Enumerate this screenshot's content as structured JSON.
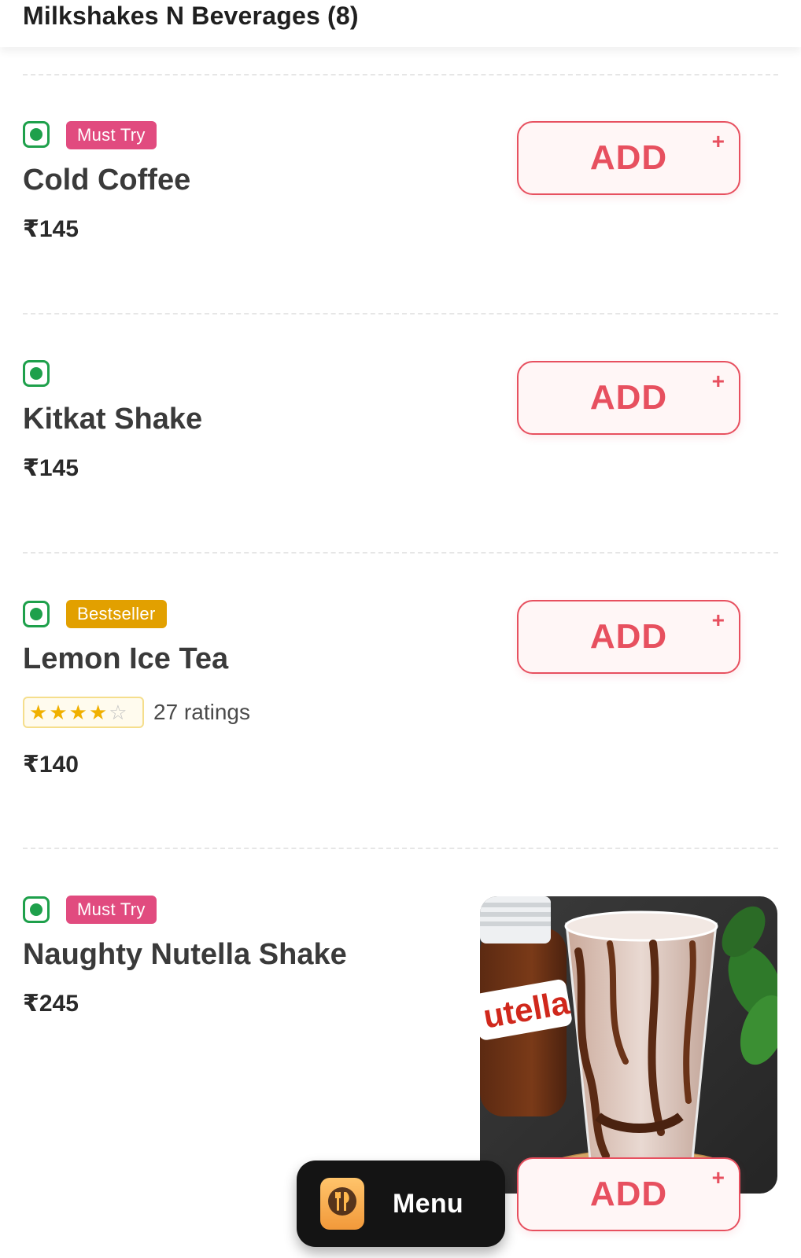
{
  "header": {
    "title": "Milkshakes N Beverages (8)"
  },
  "items": [
    {
      "name": "Cold Coffee",
      "price": "₹145",
      "badge": "Must Try",
      "add_label": "ADD",
      "plus": "+"
    },
    {
      "name": "Kitkat Shake",
      "price": "₹145",
      "badge": "",
      "add_label": "ADD",
      "plus": "+"
    },
    {
      "name": "Lemon Ice Tea",
      "price": "₹140",
      "badge": "Bestseller",
      "rating": {
        "stars": 4,
        "max": 5,
        "count_text": "27 ratings"
      },
      "add_label": "ADD",
      "plus": "+"
    },
    {
      "name": "Naughty Nutella Shake",
      "price": "₹245",
      "badge": "Must Try",
      "add_label": "ADD",
      "plus": "+",
      "image": {
        "jar_label": "utella"
      }
    }
  ],
  "menu_button": {
    "label": "Menu",
    "icon": "cutlery-icon"
  },
  "colors": {
    "veg_green": "#1ea04b",
    "add_red": "#e7505f",
    "must_try_pink": "#e14b7f",
    "bestseller_gold": "#e2a000"
  }
}
